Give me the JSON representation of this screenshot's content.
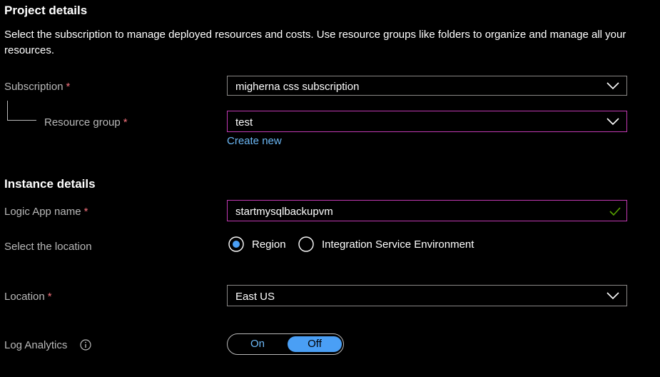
{
  "project": {
    "title": "Project details",
    "description": "Select the subscription to manage deployed resources and costs. Use resource groups like folders to organize and manage all your resources."
  },
  "subscription": {
    "label": "Subscription",
    "required": "*",
    "value": "migherna css subscription"
  },
  "resource_group": {
    "label": "Resource group",
    "required": "*",
    "value": "test",
    "create_new": "Create new"
  },
  "instance": {
    "title": "Instance details"
  },
  "logic_app_name": {
    "label": "Logic App name",
    "required": "*",
    "value": "startmysqlbackupvm"
  },
  "select_location": {
    "label": "Select the location",
    "options": [
      "Region",
      "Integration Service Environment"
    ],
    "selected": "Region"
  },
  "location": {
    "label": "Location",
    "required": "*",
    "value": "East US"
  },
  "log_analytics": {
    "label": "Log Analytics",
    "on": "On",
    "off": "Off",
    "selected": "Off"
  },
  "colors": {
    "background": "#000000",
    "required": "#f1707b",
    "link": "#6cb8f6",
    "focus_border": "#c239b3",
    "toggle_selected": "#4a9ff5",
    "valid_check": "#57a300"
  },
  "icons": {
    "dropdown": "chevron-down-icon",
    "valid": "checkmark-icon",
    "info": "info-icon"
  }
}
